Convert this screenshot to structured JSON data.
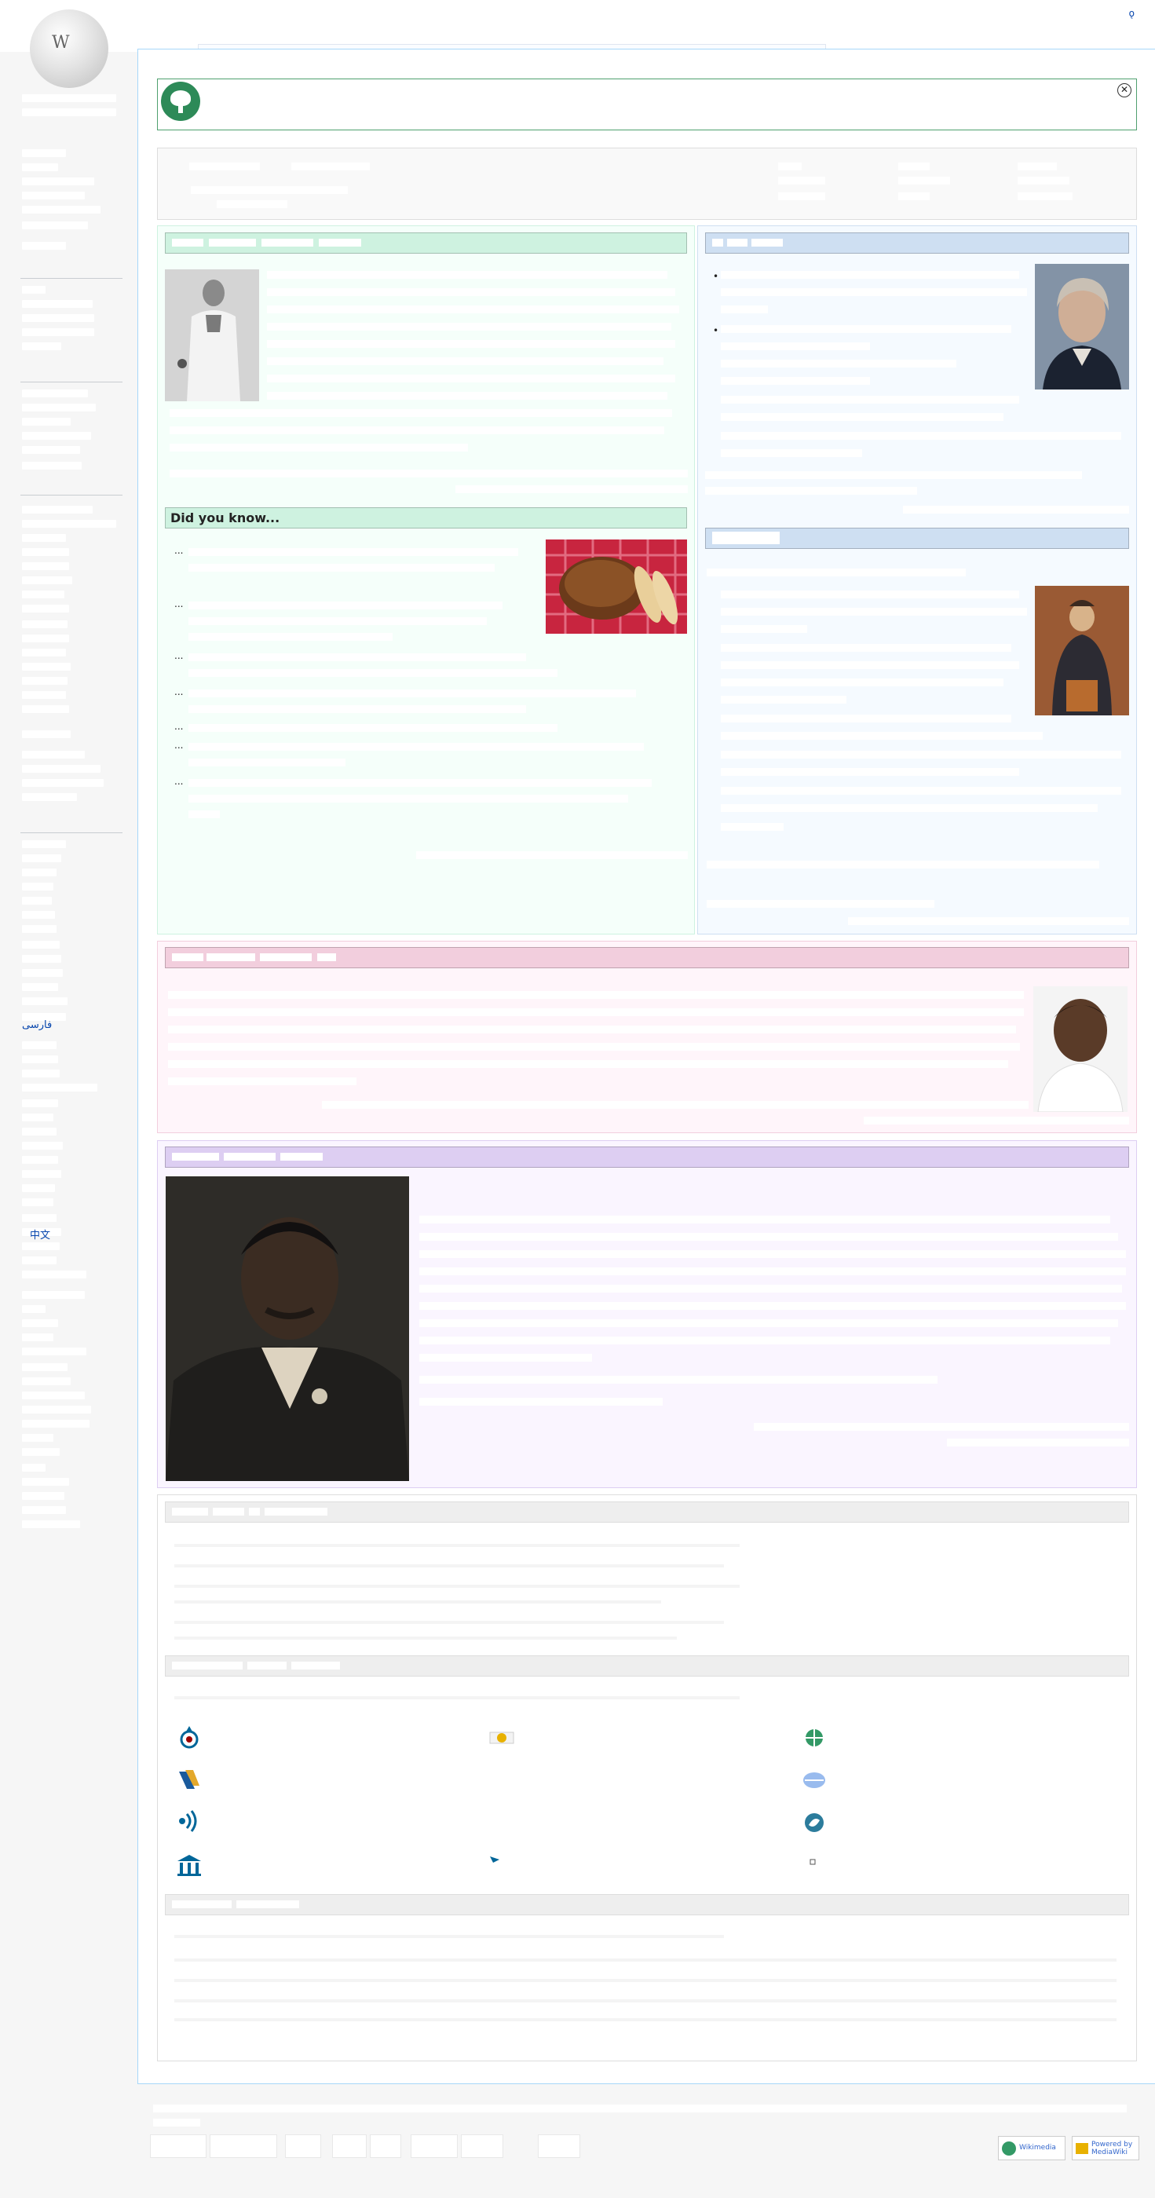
{
  "header": {
    "logo_glyph": "W",
    "user_link": "ǫ"
  },
  "sidebar": {
    "links": [
      {
        "label": "فارسی"
      },
      {
        "label": "中文"
      }
    ]
  },
  "banner": {
    "icon": "tree-icon",
    "close_glyph": "✕"
  },
  "dyk": {
    "heading": "Did you know...",
    "bullets": [
      "...",
      "...",
      "...",
      "...",
      "...",
      "...",
      "..."
    ]
  },
  "news": {
    "bullets": [
      "•",
      "•"
    ]
  },
  "footer": {
    "badge_wikimedia": "Wikimedia",
    "badge_mediawiki": "Powered by MediaWiki"
  },
  "colors": {
    "link": "#0645ad",
    "tfa_bg": "#f5fffa",
    "itn_bg": "#f5faff",
    "fp_bg": "#fff5fa",
    "pic_bg": "#faf5ff"
  }
}
